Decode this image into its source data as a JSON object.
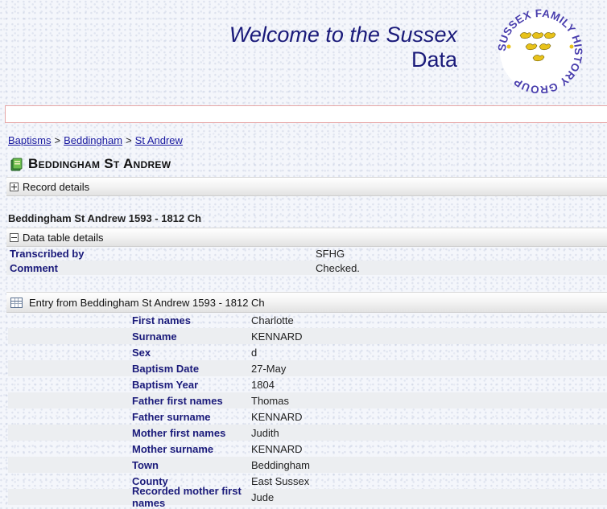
{
  "header": {
    "welcome_line1": "Welcome to the Sussex",
    "welcome_line2": "Data",
    "logo_text": "SUSSEX FAMILY HISTORY GROUP"
  },
  "search": {
    "value": ""
  },
  "breadcrumb": [
    {
      "label": "Baptisms"
    },
    {
      "label": "Beddingham"
    },
    {
      "label": "St Andrew"
    }
  ],
  "breadcrumb_separator": ">",
  "page_title": "Beddingham St Andrew",
  "record_details": {
    "label": "Record details",
    "state": "collapsed"
  },
  "dataset_title": "Beddingham St Andrew 1593 - 1812 Ch",
  "data_table_details": {
    "label": "Data table details",
    "state": "expanded",
    "rows": [
      {
        "label": "Transcribed by",
        "value": "SFHG"
      },
      {
        "label": "Comment",
        "value": "Checked."
      }
    ]
  },
  "entry": {
    "title": "Entry from Beddingham St Andrew 1593 - 1812 Ch",
    "rows": [
      {
        "label": "First names",
        "value": "Charlotte"
      },
      {
        "label": "Surname",
        "value": "KENNARD"
      },
      {
        "label": "Sex",
        "value": "d"
      },
      {
        "label": "Baptism Date",
        "value": "27-May"
      },
      {
        "label": "Baptism Year",
        "value": "1804"
      },
      {
        "label": "Father first names",
        "value": "Thomas"
      },
      {
        "label": "Father surname",
        "value": "KENNARD"
      },
      {
        "label": "Mother first names",
        "value": "Judith"
      },
      {
        "label": "Mother surname",
        "value": "KENNARD"
      },
      {
        "label": "Town",
        "value": "Beddingham"
      },
      {
        "label": "County",
        "value": "East Sussex"
      },
      {
        "label": "Recorded mother first names",
        "value": "Jude"
      }
    ]
  },
  "colors": {
    "link": "#1a1aa0",
    "label": "#1a1a7a",
    "logo_blue": "#4a3fae",
    "logo_gold": "#e8c21a"
  }
}
